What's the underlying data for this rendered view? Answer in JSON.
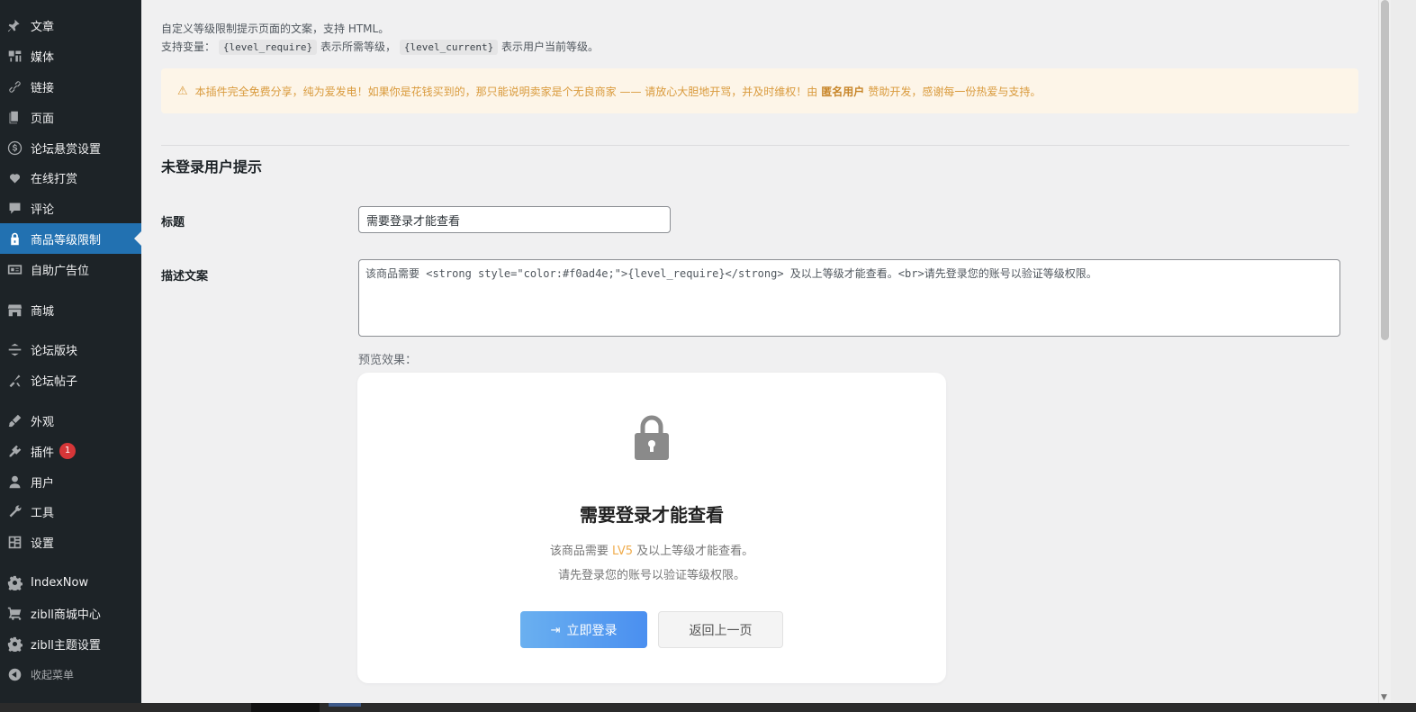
{
  "sidebar": {
    "items": [
      {
        "label": "文章",
        "icon": "pin-icon"
      },
      {
        "label": "媒体",
        "icon": "media-icon"
      },
      {
        "label": "链接",
        "icon": "link-icon"
      },
      {
        "label": "页面",
        "icon": "page-icon"
      },
      {
        "label": "论坛悬赏设置",
        "icon": "dollar-icon"
      },
      {
        "label": "在线打赏",
        "icon": "heart-icon"
      },
      {
        "label": "评论",
        "icon": "comment-icon"
      },
      {
        "label": "商品等级限制",
        "icon": "lock-icon"
      },
      {
        "label": "自助广告位",
        "icon": "ad-icon"
      },
      {
        "label": "商城",
        "icon": "store-icon"
      },
      {
        "label": "论坛版块",
        "icon": "forum-icon"
      },
      {
        "label": "论坛帖子",
        "icon": "post-icon"
      },
      {
        "label": "外观",
        "icon": "brush-icon"
      },
      {
        "label": "插件",
        "icon": "plugin-icon",
        "badge": "1"
      },
      {
        "label": "用户",
        "icon": "user-icon"
      },
      {
        "label": "工具",
        "icon": "wrench-icon"
      },
      {
        "label": "设置",
        "icon": "settings-icon"
      },
      {
        "label": "IndexNow",
        "icon": "gear-icon"
      },
      {
        "label": "zibll商城中心",
        "icon": "cart-icon"
      },
      {
        "label": "zibll主题设置",
        "icon": "gear-icon"
      },
      {
        "label": "收起菜单",
        "icon": "collapse-icon"
      }
    ]
  },
  "intro": {
    "line1": "自定义等级限制提示页面的文案，支持 HTML。",
    "line2_prefix": "支持变量：",
    "var1": "{level_require}",
    "line2_mid": "表示所需等级，",
    "var2": "{level_current}",
    "line2_suffix": "表示用户当前等级。"
  },
  "notice": {
    "text_before": "本插件完全免费分享，纯为爱发电！如果你是花钱买到的，那只能说明卖家是个无良商家 —— 请放心大胆地开骂，并及时维权！由",
    "sponsor": "匿名用户",
    "text_after": "赞助开发，感谢每一份热爱与支持。",
    "accent": "#d99a3c"
  },
  "section": {
    "title": "未登录用户提示"
  },
  "form": {
    "title_label": "标题",
    "title_value": "需要登录才能查看",
    "desc_label": "描述文案",
    "desc_value": "该商品需要 <strong style=\"color:#f0ad4e;\">{level_require}</strong> 及以上等级才能查看。<br>请先登录您的账号以验证等级权限。",
    "preview_label": "预览效果："
  },
  "preview": {
    "title": "需要登录才能查看",
    "line1_before": "该商品需要",
    "level": "LV5",
    "line1_after": "及以上等级才能查看。",
    "line2": "请先登录您的账号以验证等级权限。",
    "login_button": "立即登录",
    "back_button": "返回上一页",
    "level_color": "#f0ad4e"
  }
}
